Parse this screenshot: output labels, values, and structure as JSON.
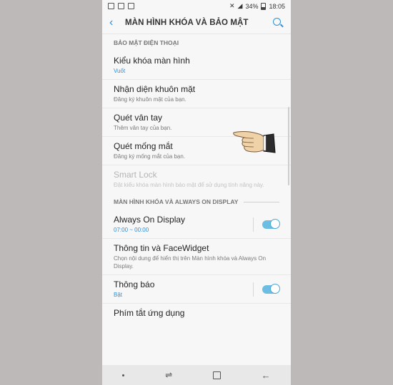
{
  "status": {
    "battery": "34%",
    "time": "18:05"
  },
  "header": {
    "title": "MÀN HÌNH KHÓA VÀ BẢO MẬT"
  },
  "sections": [
    {
      "title": "BẢO MẬT ĐIỆN THOẠI",
      "items": [
        {
          "title": "Kiểu khóa màn hình",
          "sub": "Vuốt"
        },
        {
          "title": "Nhận diện khuôn mặt",
          "sub": "Đăng ký khuôn mặt của bạn."
        },
        {
          "title": "Quét vân tay",
          "sub": "Thêm vân tay của bạn."
        },
        {
          "title": "Quét mống mắt",
          "sub": "Đăng ký mống mắt của bạn."
        },
        {
          "title": "Smart Lock",
          "sub": "Đặt kiểu khóa màn hình bảo mật để sử dụng tính năng này."
        }
      ]
    },
    {
      "title": "MÀN HÌNH KHÓA VÀ ALWAYS ON DISPLAY",
      "items": [
        {
          "title": "Always On Display",
          "sub": "07:00 ~ 00:00",
          "toggle": true
        },
        {
          "title": "Thông tin và FaceWidget",
          "sub": "Chọn nội dung để hiển thị trên Màn hình khóa và Always On Display."
        },
        {
          "title": "Thông báo",
          "sub": "Bật",
          "toggle": true
        },
        {
          "title": "Phím tắt ứng dụng",
          "sub": ""
        }
      ]
    }
  ],
  "colors": {
    "accent": "#2f8fd6",
    "toggle_on": "#6cbde2"
  }
}
